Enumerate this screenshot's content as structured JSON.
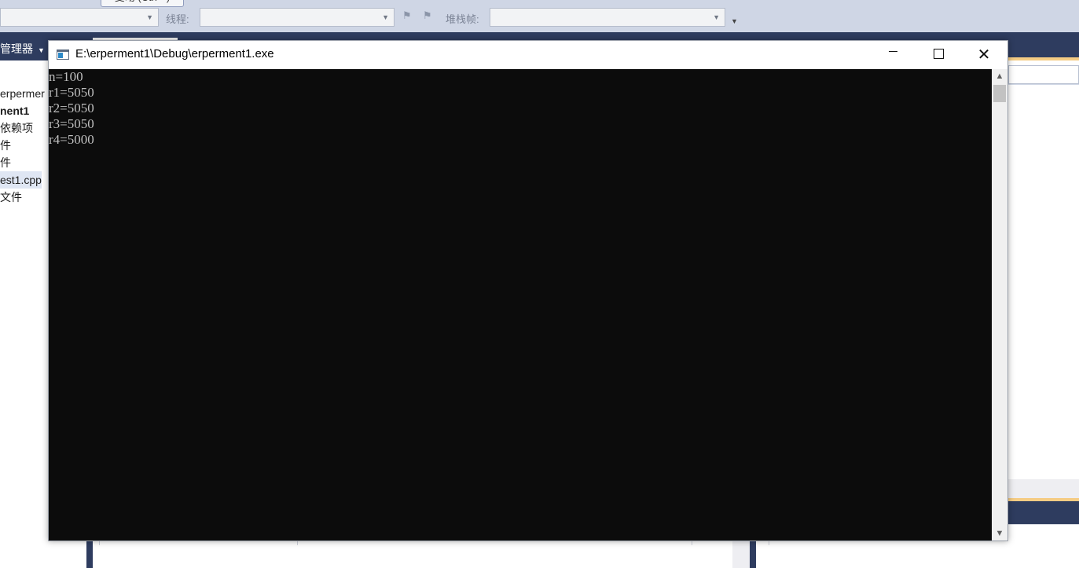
{
  "vs": {
    "tab_peek_label": "变动 (Ctrl+-)",
    "thread_label": "线程:",
    "stackframe_label": "堆栈帧:",
    "solution_explorer_title": "管理器",
    "tree_items": [
      {
        "label": "erpermer",
        "bold": false,
        "selected": false
      },
      {
        "label": "nent1",
        "bold": true,
        "selected": false
      },
      {
        "label": "依赖项",
        "bold": false,
        "selected": false
      },
      {
        "label": "件",
        "bold": false,
        "selected": false
      },
      {
        "label": "件",
        "bold": false,
        "selected": false
      },
      {
        "label": "est1.cpp",
        "bold": false,
        "selected": true
      },
      {
        "label": "文件",
        "bold": false,
        "selected": false
      }
    ]
  },
  "console": {
    "title": "E:\\erperment1\\Debug\\erperment1.exe",
    "minimize_glyph": "—",
    "close_glyph": "✕",
    "output_lines": [
      "n=100",
      "r1=5050",
      "r2=5050",
      "r3=5050",
      "r4=5000"
    ]
  },
  "colors": {
    "console_bg": "#0c0c0c",
    "console_text": "#c0c0c0",
    "vs_navy": "#2e3c5f",
    "vs_gold": "#f5cc84",
    "vs_toolbar": "#cfd6e5"
  }
}
